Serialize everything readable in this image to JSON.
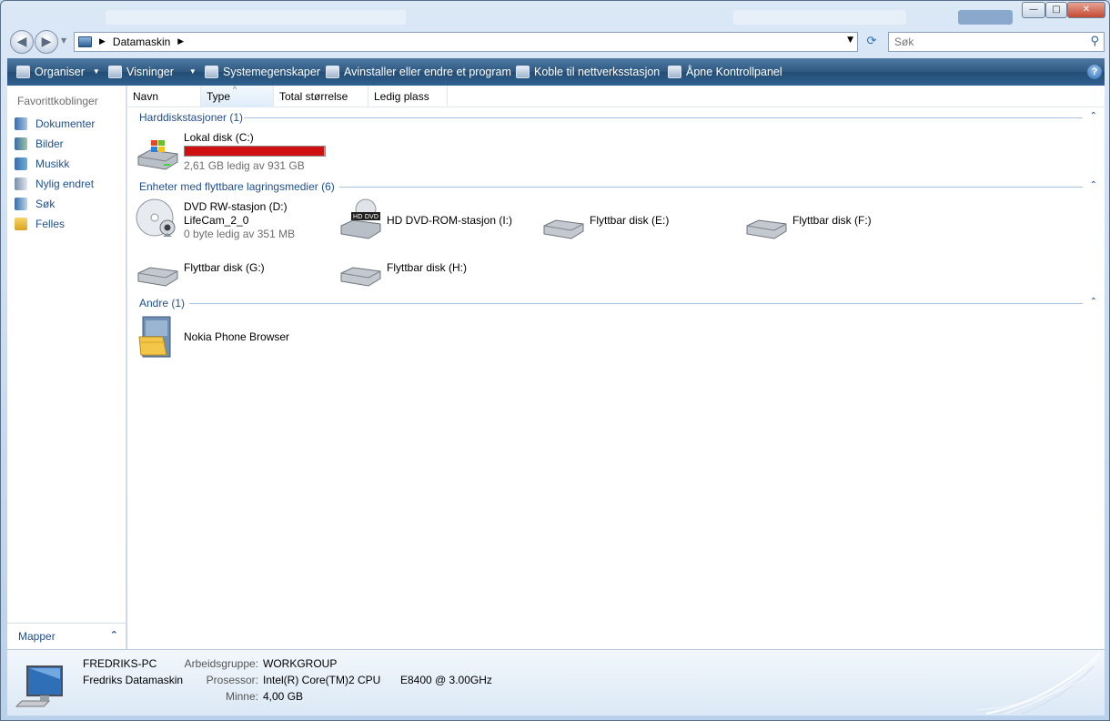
{
  "window": {
    "controls": {
      "minimize": "—",
      "maximize": "□",
      "close": "✕"
    }
  },
  "nav": {
    "back_icon": "arrow-left",
    "forward_icon": "arrow-right",
    "breadcrumb": {
      "computer_icon": "computer-icon",
      "location": "Datamaskin"
    },
    "search_placeholder": "Søk"
  },
  "toolbar": {
    "organize": "Organiser",
    "views": "Visninger",
    "system_properties": "Systemegenskaper",
    "uninstall": "Avinstaller eller endre et program",
    "map_drive": "Koble til nettverksstasjon",
    "control_panel": "Åpne Kontrollpanel",
    "help": "?"
  },
  "sidebar": {
    "title": "Favorittkoblinger",
    "items": [
      {
        "label": "Dokumenter",
        "icon": "documents-icon"
      },
      {
        "label": "Bilder",
        "icon": "pictures-icon"
      },
      {
        "label": "Musikk",
        "icon": "music-icon"
      },
      {
        "label": "Nylig endret",
        "icon": "recently-changed-icon"
      },
      {
        "label": "Søk",
        "icon": "search-icon"
      },
      {
        "label": "Felles",
        "icon": "folder-icon"
      }
    ],
    "folders": "Mapper"
  },
  "columns": [
    "Navn",
    "Type",
    "Total størrelse",
    "Ledig plass"
  ],
  "groups": {
    "hdd": {
      "title": "Harddiskstasjoner (1)",
      "items": [
        {
          "name": "Lokal disk (C:)",
          "free": "2,61 GB ledig av 931 GB",
          "used_fraction": 0.997
        }
      ]
    },
    "removable": {
      "title": "Enheter med flyttbare lagringsmedier (6)",
      "items": [
        {
          "name": "DVD RW-stasjon (D:)",
          "label": "LifeCam_2_0",
          "free": "0 byte ledig av 351 MB"
        },
        {
          "name": "HD DVD-ROM-stasjon (I:)",
          "badge": "HD DVD"
        },
        {
          "name": "Flyttbar disk (E:)"
        },
        {
          "name": "Flyttbar disk (F:)"
        },
        {
          "name": "Flyttbar disk (G:)"
        },
        {
          "name": "Flyttbar disk (H:)"
        }
      ]
    },
    "other": {
      "title": "Andre (1)",
      "items": [
        {
          "name": "Nokia Phone Browser"
        }
      ]
    }
  },
  "details": {
    "pc_name": "FREDRIKS-PC",
    "description": "Fredriks Datamaskin",
    "workgroup_label": "Arbeidsgruppe:",
    "workgroup": "WORKGROUP",
    "processor_label": "Prosessor:",
    "processor": "Intel(R) Core(TM)2 CPU",
    "processor_model": "E8400  @ 3.00GHz",
    "memory_label": "Minne:",
    "memory": "4,00 GB"
  },
  "colors": {
    "accent": "#1e4e92",
    "toolbar": "#2e5880",
    "usage_bar": "#d01010"
  }
}
